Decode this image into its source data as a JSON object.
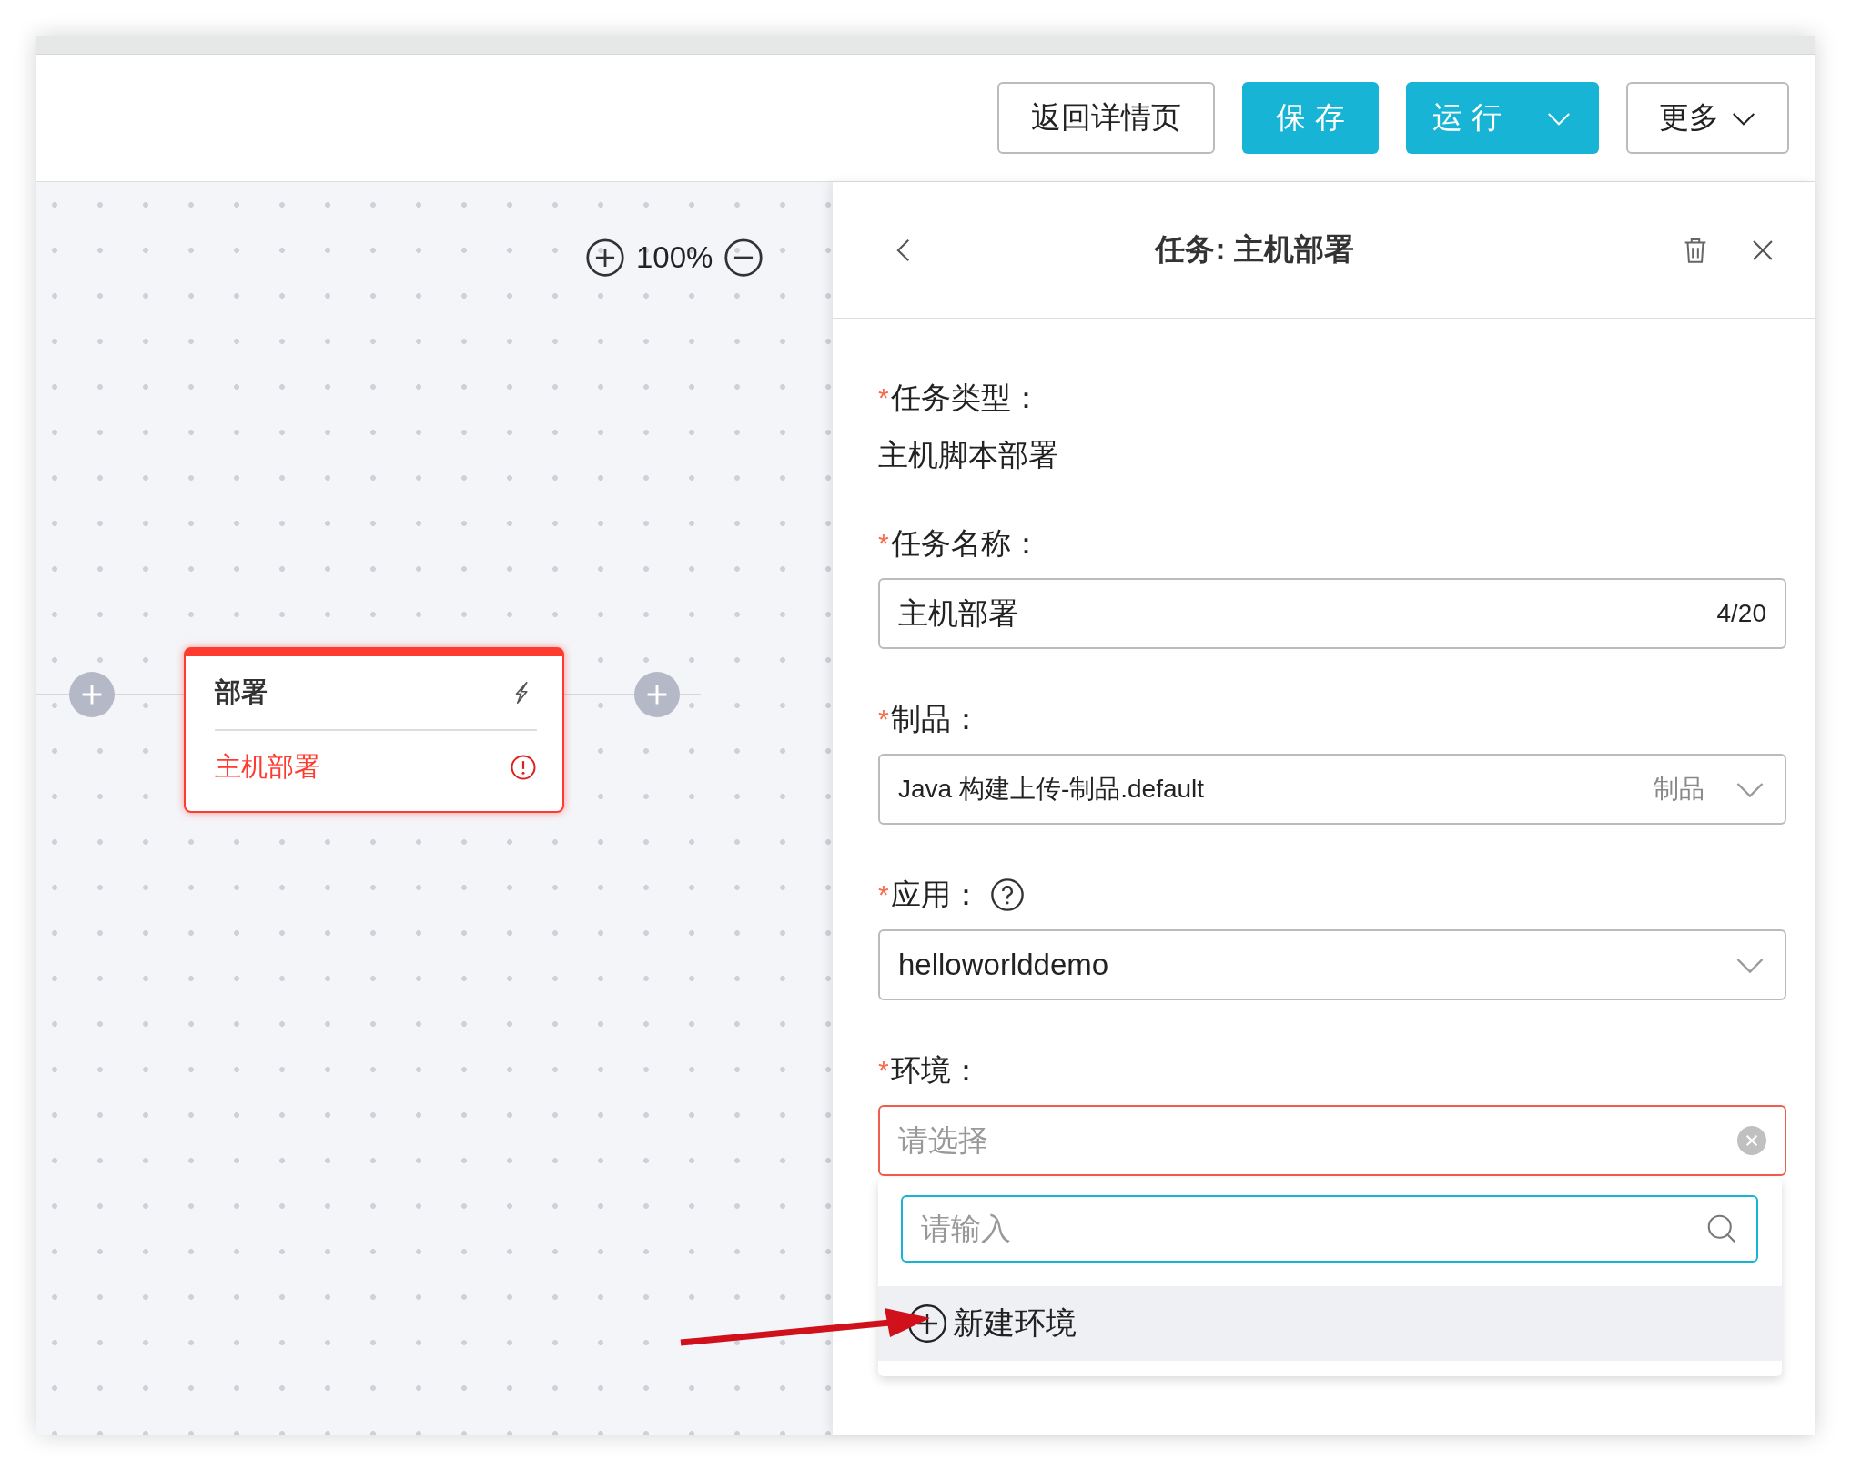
{
  "toolbar": {
    "buttons": [
      {
        "label": "返回详情页",
        "kind": "default"
      },
      {
        "label": "保 存",
        "kind": "primary"
      },
      {
        "label": "运 行",
        "kind": "split"
      },
      {
        "label": "更多",
        "kind": "dropdown"
      }
    ]
  },
  "canvas": {
    "zoom": "100%",
    "node": {
      "title": "部署",
      "task": "主机部署",
      "error": true
    }
  },
  "panel": {
    "title": "任务: 主机部署",
    "fields": [
      {
        "required_mark": "*",
        "label": "任务类型：",
        "kind": "static",
        "value": "主机脚本部署"
      },
      {
        "required_mark": "*",
        "label": "任务名称：",
        "kind": "text",
        "value": "主机部署",
        "counter": "4/20"
      },
      {
        "required_mark": "*",
        "label": "制品：",
        "kind": "select",
        "value": "Java 构建上传-制品.default",
        "suffix": "制品"
      },
      {
        "required_mark": "*",
        "label": "应用：",
        "kind": "select",
        "value": "helloworlddemo",
        "help": true
      },
      {
        "required_mark": "*",
        "label": "环境：",
        "kind": "select",
        "placeholder": "请选择",
        "error": true,
        "open": true,
        "dropdown": {
          "search_placeholder": "请输入",
          "options": [
            {
              "label": "新建环境",
              "kind": "create",
              "highlighted": true
            }
          ]
        }
      }
    ]
  }
}
